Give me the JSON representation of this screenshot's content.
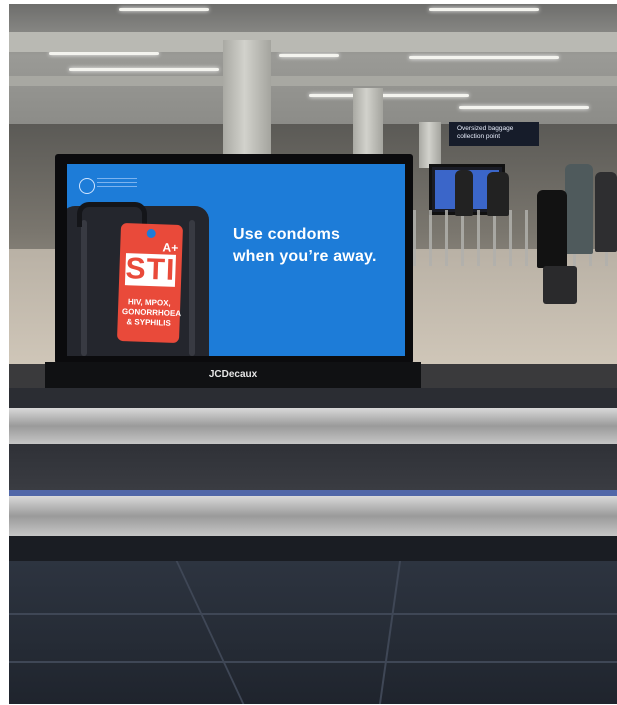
{
  "airport_sign": {
    "oversized_line1": "Oversized baggage",
    "oversized_line2": "collection point"
  },
  "billboard": {
    "tag_grade": "A+",
    "tag_big_text": "STI",
    "tag_small_text": "HIV, MPOX, GONORRHOEA & SYPHILIS",
    "headline_line1": "Use condoms",
    "headline_line2": "when you’re away.",
    "brand": "JCDecaux",
    "colors": {
      "screen": "#1d7cd8",
      "tag": "#e94a3a"
    }
  }
}
